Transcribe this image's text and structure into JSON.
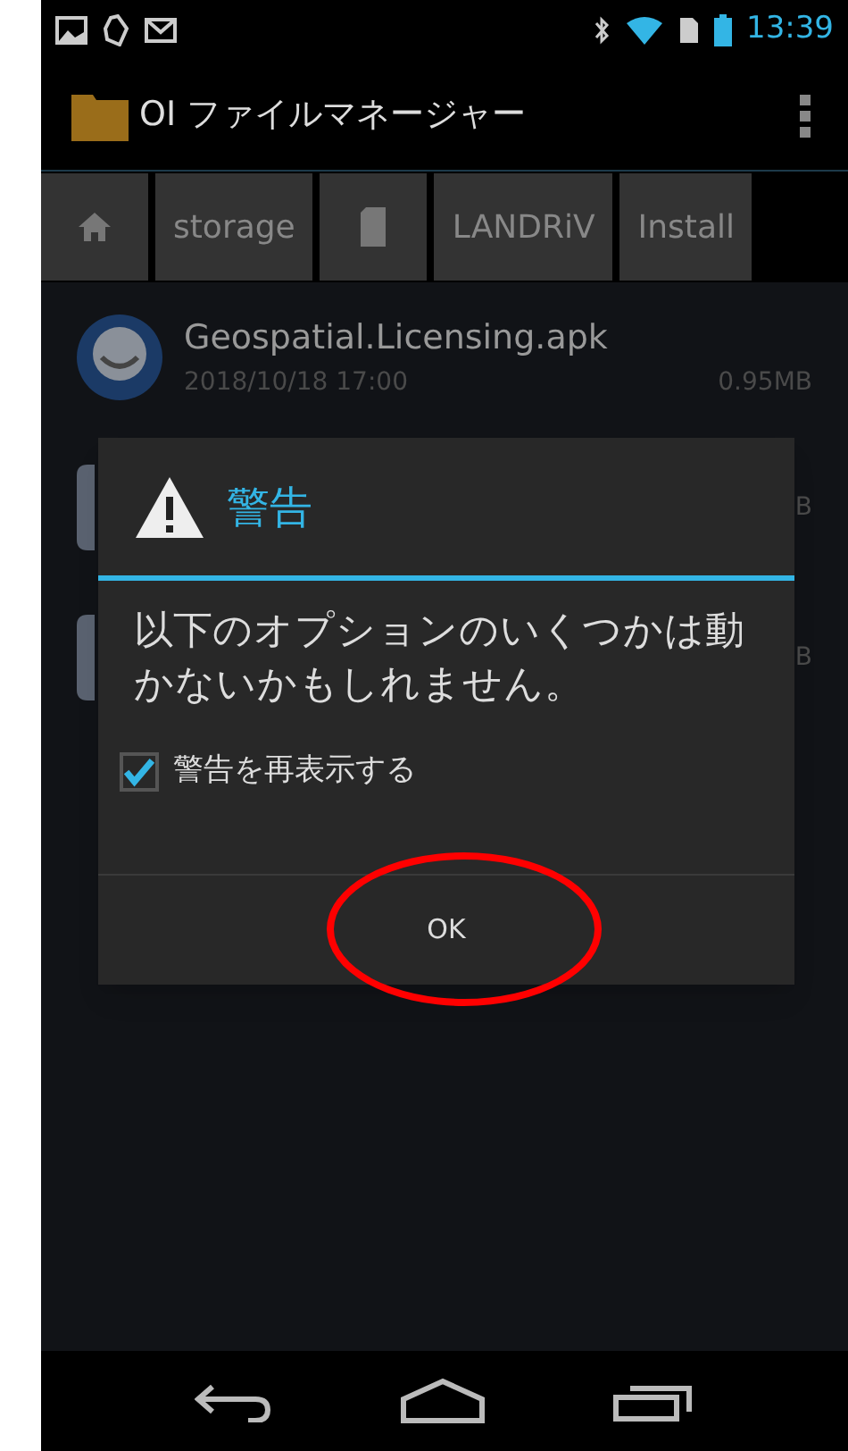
{
  "status_bar": {
    "time": "13:39"
  },
  "app_bar": {
    "title": "OI ファイルマネージャー"
  },
  "breadcrumbs": [
    {
      "kind": "home"
    },
    {
      "kind": "text",
      "label": "storage"
    },
    {
      "kind": "sdcard"
    },
    {
      "kind": "text",
      "label": "LANDRiV"
    },
    {
      "kind": "text",
      "label": "Install"
    }
  ],
  "files": [
    {
      "name": "Geospatial.Licensing.apk",
      "date": "2018/10/18 17:00",
      "size": "0.95MB"
    },
    {
      "size": "B"
    },
    {
      "size": "B"
    }
  ],
  "dialog": {
    "title": "警告",
    "message": "以下のオプションのいくつかは動かないかもしれません。",
    "checkbox": {
      "label": "警告を再表示する",
      "checked": true
    },
    "button": {
      "label": "OK",
      "highlighted": true
    }
  }
}
